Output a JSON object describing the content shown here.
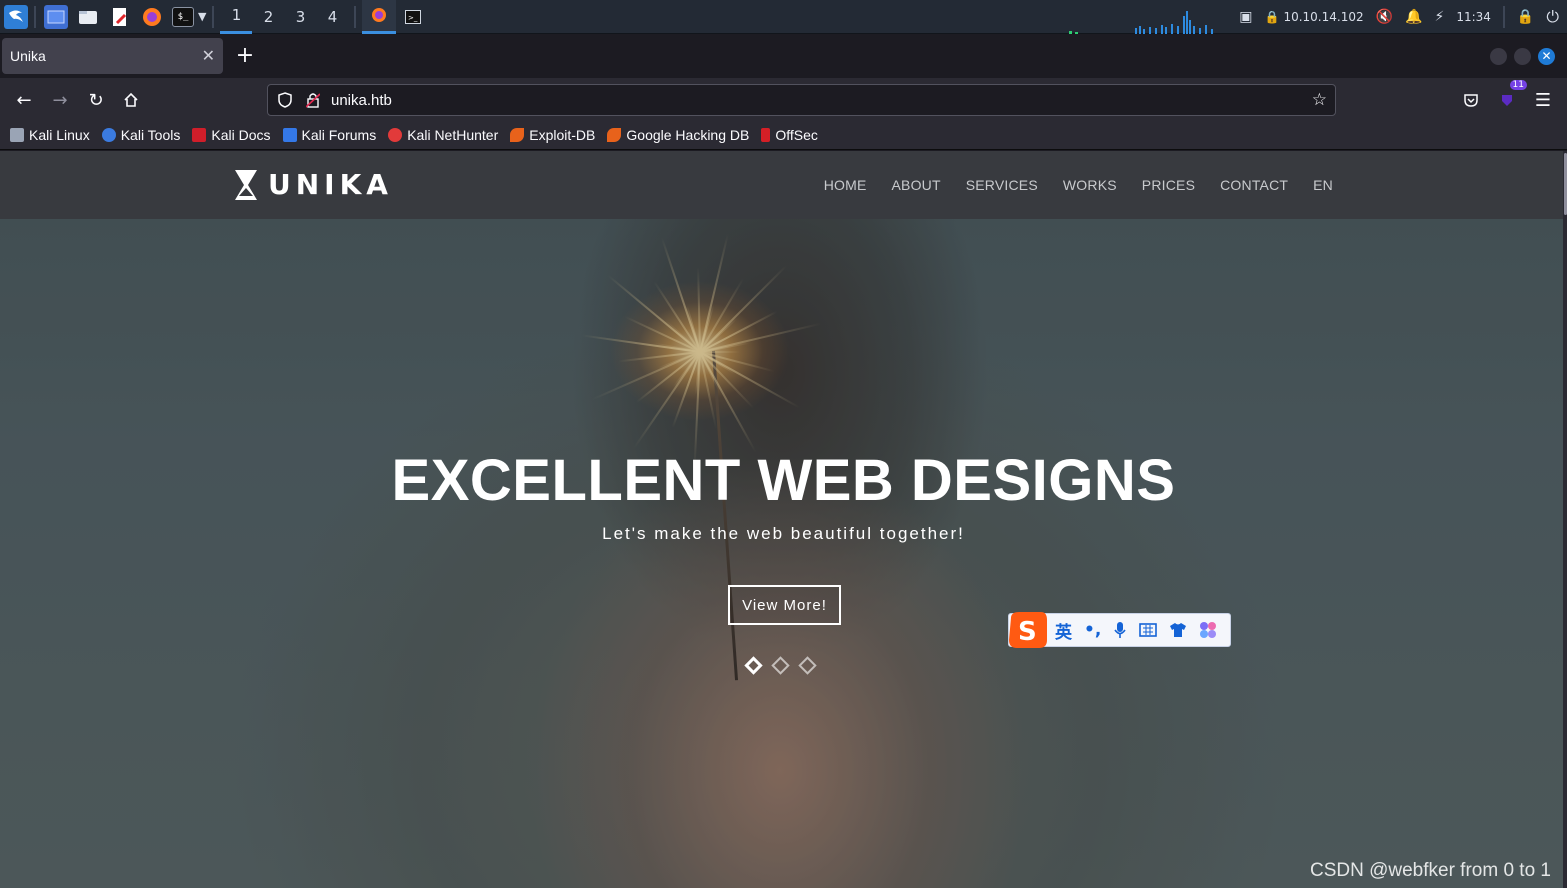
{
  "taskbar": {
    "workspaces": [
      "1",
      "2",
      "3",
      "4"
    ],
    "active_workspace": "1",
    "ip_address": "10.10.14.102",
    "clock": "11:34",
    "icons": [
      "kali-menu-icon",
      "desktop-icon",
      "file-manager-icon",
      "text-editor-icon",
      "firefox-icon",
      "terminal-icon"
    ]
  },
  "browser": {
    "tab_title": "Unika",
    "url": "unika.htb",
    "extension_badge": "11",
    "bookmarks": [
      {
        "label": "Kali Linux",
        "color": "#9aa4b5"
      },
      {
        "label": "Kali Tools",
        "color": "#3b7be0"
      },
      {
        "label": "Kali Docs",
        "color": "#d01e2a"
      },
      {
        "label": "Kali Forums",
        "color": "#3478e8"
      },
      {
        "label": "Kali NetHunter",
        "color": "#e23a3a"
      },
      {
        "label": "Exploit-DB",
        "color": "#e8621b"
      },
      {
        "label": "Google Hacking DB",
        "color": "#e8621b"
      },
      {
        "label": "OffSec",
        "color": "#d41f26"
      }
    ]
  },
  "site": {
    "logo_text": "UNIKA",
    "menu": [
      "HOME",
      "ABOUT",
      "SERVICES",
      "WORKS",
      "PRICES",
      "CONTACT",
      "EN"
    ],
    "headline": "EXCELLENT WEB DESIGNS",
    "subheadline": "Let's make the web beautiful together!",
    "cta_label": "View More!",
    "slides_total": 3,
    "active_slide": 1
  },
  "ime": {
    "lang_label": "英",
    "punct_label": "•,"
  },
  "watermark": "CSDN @webfker from 0 to 1",
  "colors": {
    "accent": "#3b8fe0",
    "header_bg": "#383a3f",
    "ime_blue": "#1463d6"
  }
}
